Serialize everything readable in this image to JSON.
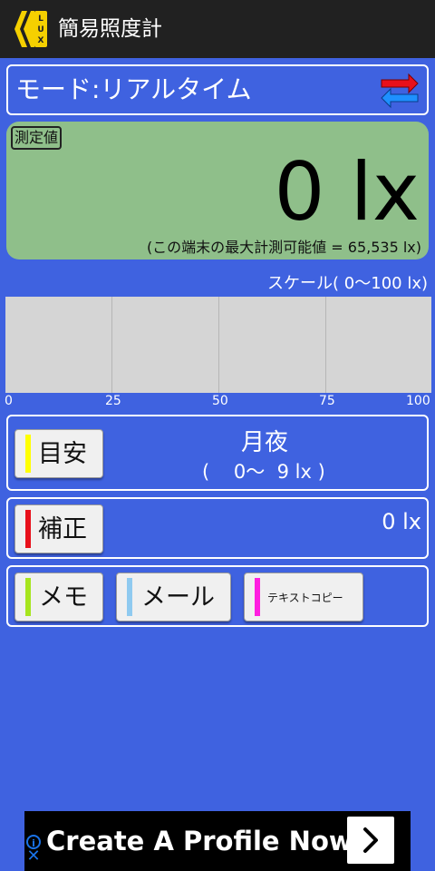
{
  "app": {
    "title": "簡易照度計",
    "icon_letters": "LUX"
  },
  "mode": {
    "label": "モード:リアルタイム"
  },
  "measurement": {
    "tag": "測定値",
    "value": "0 lx",
    "max_note": "(この端末の最大計測可能値 = 65,535 lx)",
    "level": 0
  },
  "scale": {
    "label": "スケール(  0〜100 lx)",
    "ticks": [
      "0",
      "25",
      "50",
      "75",
      "100"
    ]
  },
  "guide": {
    "button_label": "目安",
    "name": "月夜",
    "range": "(    0〜  9 lx )"
  },
  "correction": {
    "button_label": "補正",
    "value": "0 lx"
  },
  "actions": {
    "memo": "メモ",
    "mail": "メール",
    "copy": "テキストコピー"
  },
  "ad": {
    "text": "Create A Profile Now"
  },
  "colors": {
    "background": "#3f62e0",
    "appbar": "#212121",
    "measure_panel": "#8fbf8a",
    "guide_strip": "#ffff00",
    "correction_strip": "#e8101b",
    "memo_strip": "#a6e51e",
    "mail_strip": "#8fcaf0",
    "copy_strip": "#ff1fe0"
  }
}
